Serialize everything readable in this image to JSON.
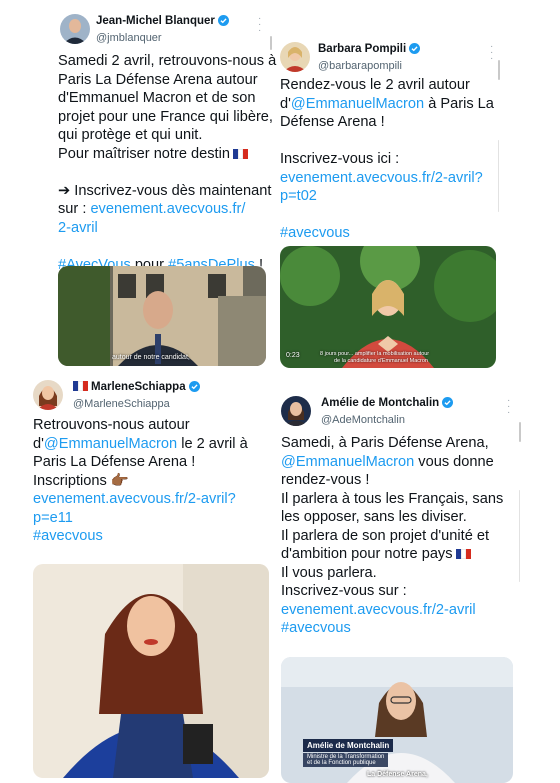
{
  "tweets": [
    {
      "name": "Jean-Michel Blanquer",
      "handle": "@jmblanquer",
      "lines": [
        {
          "parts": [
            {
              "t": "Samedi 2 avril, retrouvons-nous à"
            }
          ]
        },
        {
          "parts": [
            {
              "t": "Paris La Défense Arena autour"
            }
          ]
        },
        {
          "parts": [
            {
              "t": "d'Emmanuel Macron et de son"
            }
          ]
        },
        {
          "parts": [
            {
              "t": "projet pour une France qui libère,"
            }
          ]
        },
        {
          "parts": [
            {
              "t": "qui protège et qui unit."
            }
          ]
        },
        {
          "parts": [
            {
              "t": "Pour maîtriser notre destin"
            }
          ],
          "flag": true
        },
        {
          "gap": true
        },
        {
          "parts": [
            {
              "t": "➔ Inscrivez-vous dès maintenant"
            }
          ]
        },
        {
          "parts": [
            {
              "t": "sur : "
            },
            {
              "t": "evenement.avecvous.fr/",
              "link": true
            }
          ]
        },
        {
          "parts": [
            {
              "t": "2-avril",
              "link": true
            }
          ]
        },
        {
          "gap": true
        },
        {
          "parts": [
            {
              "t": "#AvecVous",
              "link": true
            },
            {
              "t": " pour "
            },
            {
              "t": "#5ansDePlus",
              "link": true
            },
            {
              "t": " !"
            }
          ]
        }
      ],
      "video_caption": "autour de notre candidat,"
    },
    {
      "name": "Barbara Pompili",
      "handle": "@barbarapompili",
      "lines": [
        {
          "parts": [
            {
              "t": "Rendez-vous le 2 avril autour"
            }
          ]
        },
        {
          "parts": [
            {
              "t": "d'"
            },
            {
              "t": "@EmmanuelMacron",
              "link": true
            },
            {
              "t": " à Paris La"
            }
          ]
        },
        {
          "parts": [
            {
              "t": "Défense Arena !"
            }
          ]
        },
        {
          "gap": true
        },
        {
          "parts": [
            {
              "t": "Inscrivez-vous ici :"
            }
          ]
        },
        {
          "parts": [
            {
              "t": "evenement.avecvous.fr/2-avril?",
              "link": true
            }
          ]
        },
        {
          "parts": [
            {
              "t": "p=t02",
              "link": true
            }
          ]
        },
        {
          "gap": true
        },
        {
          "parts": [
            {
              "t": "#avecvous",
              "link": true
            }
          ]
        }
      ],
      "video_time": "0:23",
      "video_caption_1": "8 jours pour... amplifier la mobilisation autour",
      "video_caption_2": "de la candidature d'Emmanuel Macron"
    },
    {
      "name": "MarleneSchiappa",
      "handle": "@MarleneSchiappa",
      "lines": [
        {
          "parts": [
            {
              "t": "Retrouvons-nous autour"
            }
          ]
        },
        {
          "parts": [
            {
              "t": "d'"
            },
            {
              "t": "@EmmanuelMacron",
              "link": true
            },
            {
              "t": " le 2 avril à"
            }
          ]
        },
        {
          "parts": [
            {
              "t": "Paris La Défense Arena !"
            }
          ]
        },
        {
          "parts": [
            {
              "t": "Inscriptions "
            }
          ],
          "emoji": "👉🏾"
        },
        {
          "parts": [
            {
              "t": "evenement.avecvous.fr/2-avril?",
              "link": true
            }
          ]
        },
        {
          "parts": [
            {
              "t": "p=e11",
              "link": true
            }
          ]
        },
        {
          "parts": [
            {
              "t": "#avecvous",
              "link": true
            }
          ]
        }
      ]
    },
    {
      "name": "Amélie de Montchalin",
      "handle": "@AdeMontchalin",
      "lines": [
        {
          "parts": [
            {
              "t": "Samedi, à Paris Défense Arena,"
            }
          ]
        },
        {
          "parts": [
            {
              "t": "@EmmanuelMacron",
              "link": true
            },
            {
              "t": " vous donne"
            }
          ]
        },
        {
          "parts": [
            {
              "t": "rendez-vous !"
            }
          ]
        },
        {
          "parts": [
            {
              "t": "Il parlera à tous les Français, sans"
            }
          ]
        },
        {
          "parts": [
            {
              "t": "les opposer, sans les diviser."
            }
          ]
        },
        {
          "parts": [
            {
              "t": "Il parlera de son projet d'unité et"
            }
          ]
        },
        {
          "parts": [
            {
              "t": "d'ambition pour notre pays"
            }
          ],
          "flag": true
        },
        {
          "parts": [
            {
              "t": "Il vous parlera."
            }
          ]
        },
        {
          "parts": [
            {
              "t": "Inscrivez-vous sur :"
            }
          ]
        },
        {
          "parts": [
            {
              "t": "evenement.avecvous.fr/2-avril",
              "link": true
            }
          ]
        },
        {
          "parts": [
            {
              "t": "#avecvous",
              "link": true
            }
          ]
        }
      ],
      "lower_third_name": "Amélie de Montchalin",
      "lower_third_title_1": "Ministre de la Transformation",
      "lower_third_title_2": "et de la Fonction publique",
      "video_caption": "La Défense Arena,"
    }
  ],
  "colors": {
    "link": "#1d9bf0",
    "verified": "#1d9bf0",
    "handle": "#536471"
  },
  "icons": [
    "verified-badge-icon",
    "french-flag-icon",
    "more-options-icon",
    "backhand-index-pointing-right-icon"
  ]
}
